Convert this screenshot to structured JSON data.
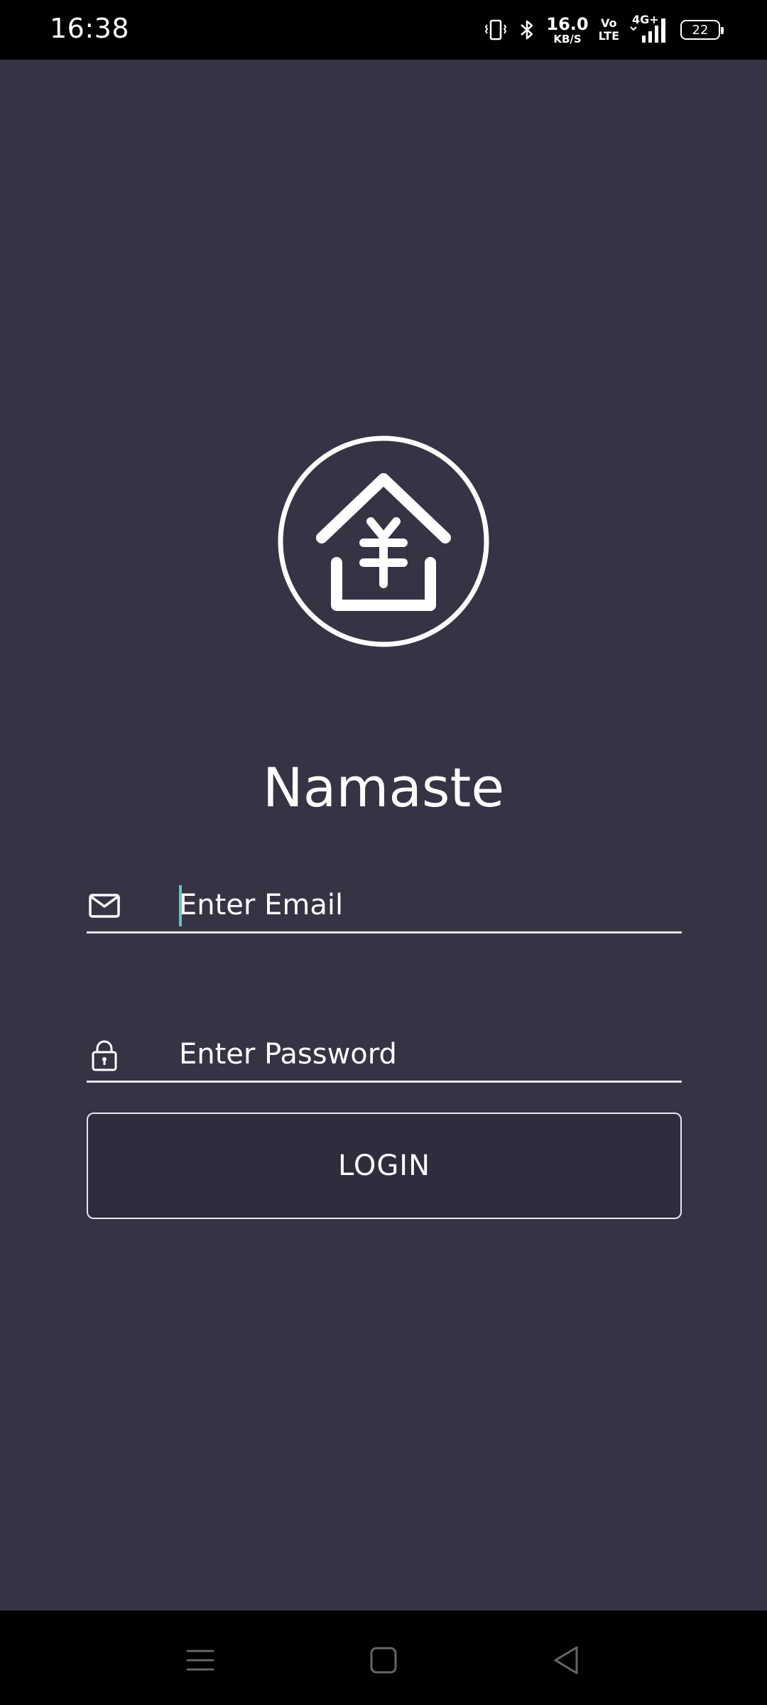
{
  "status_bar": {
    "time": "16:38",
    "net_speed_value": "16.0",
    "net_speed_unit": "KB/S",
    "volte_top": "Vo",
    "volte_bottom": "LTE",
    "network_type": "4G+",
    "battery_level": "22",
    "icons": [
      "vibrate-icon",
      "bluetooth-icon",
      "signal-icon",
      "battery-icon"
    ]
  },
  "app": {
    "title": "Namaste",
    "logo_icon": "house-yen-logo-icon",
    "email_field": {
      "placeholder": "Enter Email",
      "value": "",
      "icon": "mail-icon"
    },
    "password_field": {
      "placeholder": "Enter Password",
      "value": "",
      "icon": "lock-icon"
    },
    "login_label": "LOGIN"
  },
  "nav_bar": {
    "icons": [
      "menu-icon",
      "home-square-icon",
      "back-triangle-icon"
    ]
  },
  "colors": {
    "background": "#363345",
    "button_fill": "#2f2c3d",
    "text": "#ffffff",
    "caret": "#5fc8c0"
  }
}
